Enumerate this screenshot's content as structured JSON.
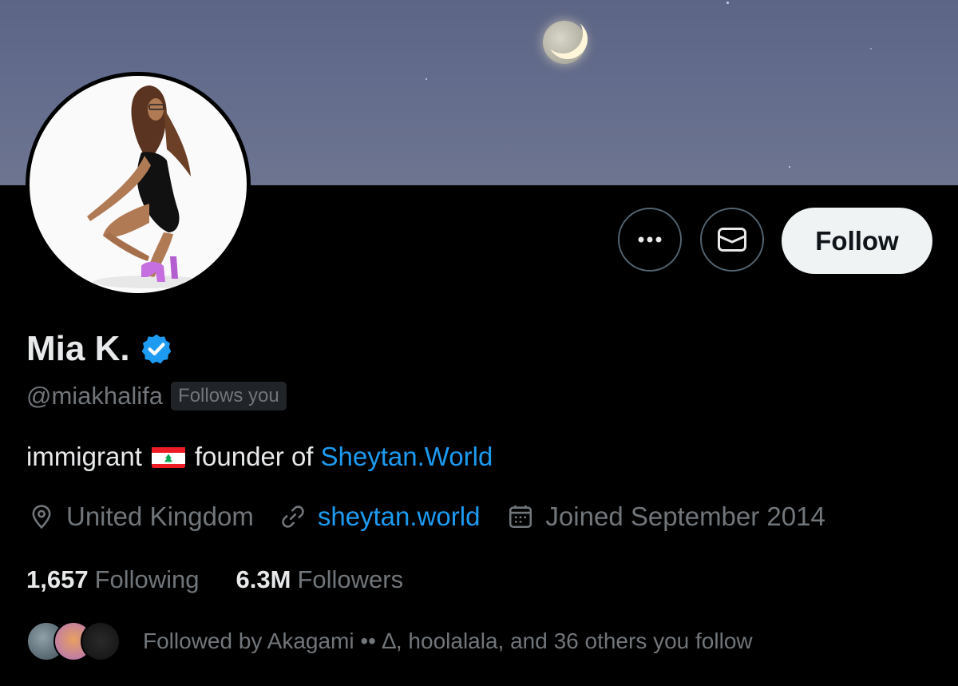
{
  "profile": {
    "display_name": "Mia K.",
    "handle": "@miakhalifa",
    "follows_you_badge": "Follows you",
    "bio_prefix": "immigrant",
    "bio_middle": "founder of",
    "bio_link": "Sheytan.World",
    "location": "United Kingdom",
    "website": "sheytan.world",
    "joined": "Joined September 2014"
  },
  "stats": {
    "following_count": "1,657",
    "following_label": "Following",
    "followers_count": "6.3M",
    "followers_label": "Followers"
  },
  "actions": {
    "follow_label": "Follow"
  },
  "followed_by": {
    "text": "Followed by Akagami •• ∆, hoolalala, and 36 others you follow"
  },
  "icons": {
    "more": "more-horizontal-icon",
    "message": "envelope-icon",
    "verified": "verified-badge-icon",
    "location": "location-pin-icon",
    "link": "link-icon",
    "calendar": "calendar-icon",
    "flag": "lebanon-flag-icon"
  },
  "colors": {
    "background": "#000000",
    "text_primary": "#e7e9ea",
    "text_secondary": "#71767b",
    "link": "#1d9bf0",
    "verified": "#1d9bf0",
    "follow_button": "#eff3f4"
  }
}
